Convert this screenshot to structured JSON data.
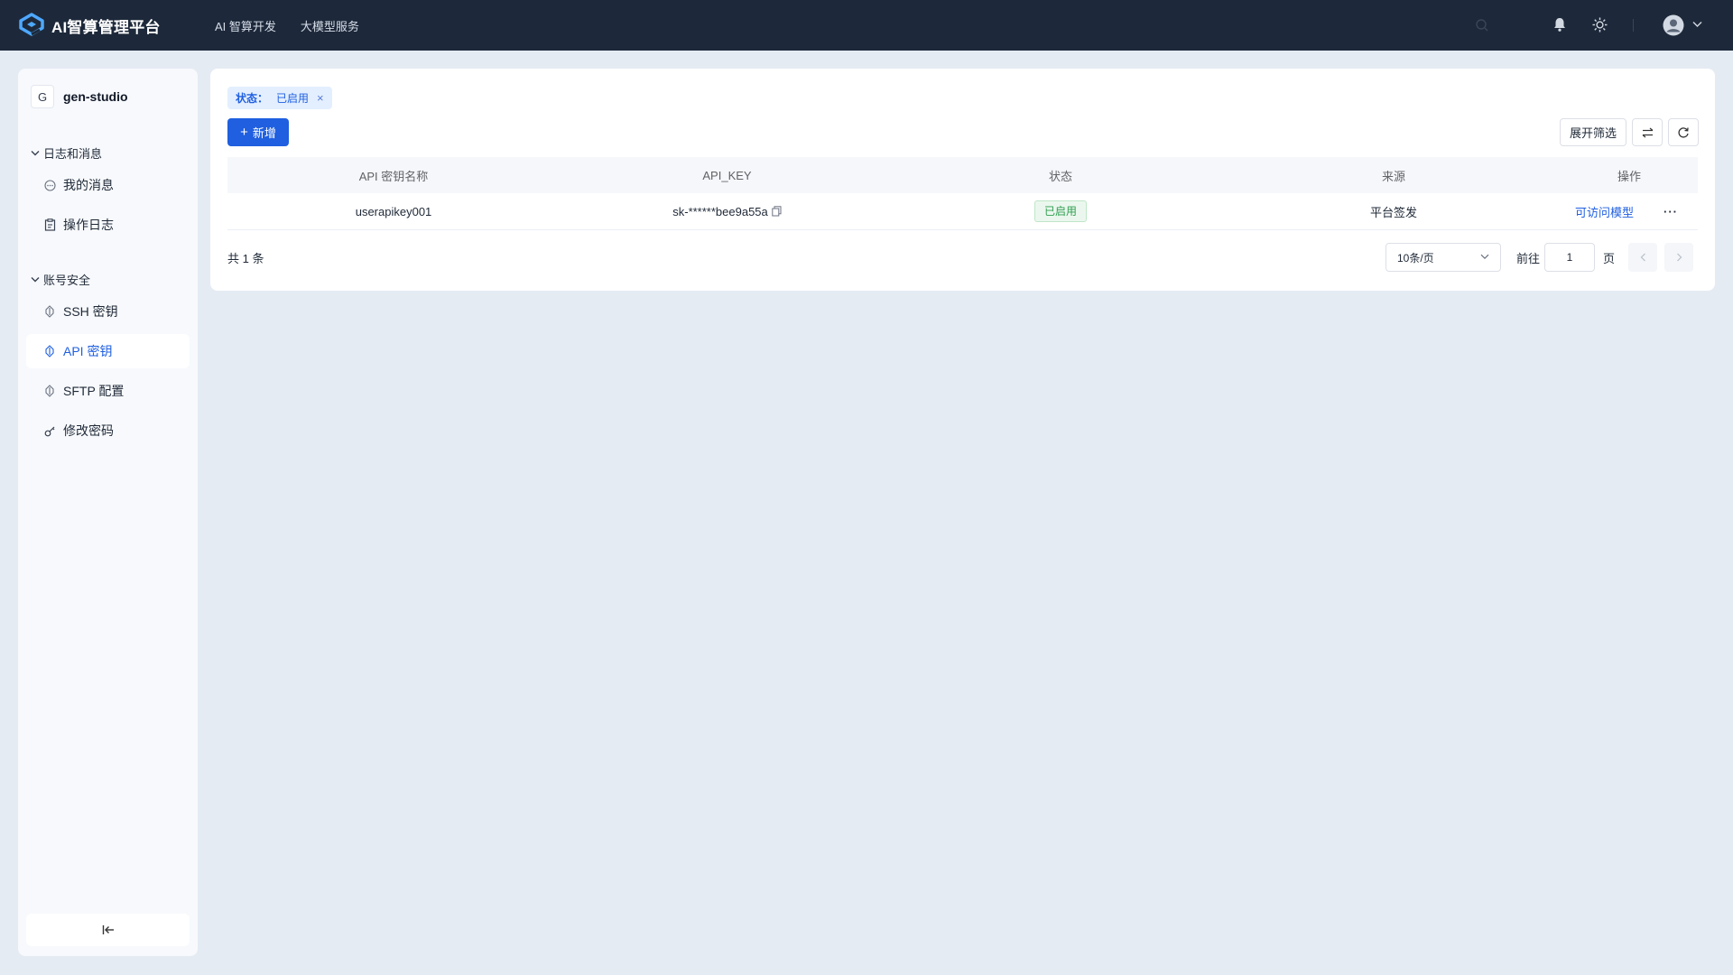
{
  "app": {
    "title": "AI智算管理平台",
    "logo_icon": "platform-logo-icon"
  },
  "topnav": {
    "items": [
      {
        "label": "AI 智算开发"
      },
      {
        "label": "大模型服务"
      }
    ]
  },
  "top_right_icons": [
    "search-icon",
    "bell-icon",
    "sun-icon",
    "avatar-icon",
    "chevron-down-icon"
  ],
  "sidebar": {
    "project": {
      "initial": "G",
      "name": "gen-studio"
    },
    "groups": [
      {
        "title": "日志和消息",
        "items": [
          {
            "label": "我的消息",
            "icon": "message-icon"
          },
          {
            "label": "操作日志",
            "icon": "clipboard-icon"
          }
        ]
      },
      {
        "title": "账号安全",
        "items": [
          {
            "label": "SSH 密钥",
            "icon": "key-icon"
          },
          {
            "label": "API 密钥",
            "icon": "key-icon",
            "active": true
          },
          {
            "label": "SFTP 配置",
            "icon": "key-icon"
          },
          {
            "label": "修改密码",
            "icon": "password-key-icon"
          }
        ]
      }
    ],
    "collapse_icon": "collapse-left-icon"
  },
  "main": {
    "filter_tag": {
      "label": "状态：",
      "value": "已启用"
    },
    "add_button": "新增",
    "expand_filter_button": "展开筛选",
    "table": {
      "headers": [
        "API 密钥名称",
        "API_KEY",
        "状态",
        "来源",
        "操作"
      ],
      "rows": [
        {
          "name": "userapikey001",
          "api_key": "sk-******bee9a55a",
          "status": "已启用",
          "source": "平台签发",
          "action": "可访问模型"
        }
      ]
    },
    "pagination": {
      "total": "共 1 条",
      "page_size": "10条/页",
      "goto_label": "前往",
      "page": "1",
      "page_unit": "页"
    }
  },
  "colors": {
    "topbar": "#1d293a",
    "primary": "#1f5fe0",
    "background": "#e5ebf3",
    "success": "#2e9e4f"
  }
}
